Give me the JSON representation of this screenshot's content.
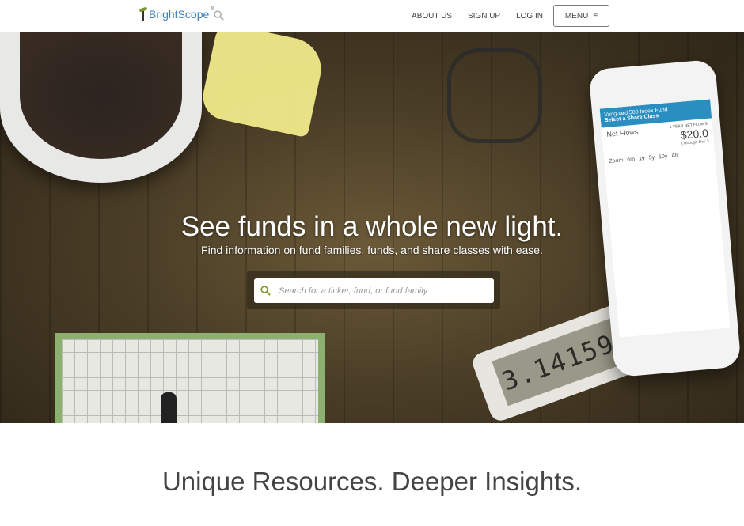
{
  "header": {
    "logo_text": "BrightScope",
    "logo_suffix": "®",
    "nav": [
      "ABOUT US",
      "SIGN UP",
      "LOG IN"
    ],
    "menu_label": "MENU"
  },
  "hero": {
    "title": "See funds in a whole new light.",
    "subtitle": "Find information on fund families, funds, and share classes with ease.",
    "search_placeholder": "Search for a ticker, fund, or fund family",
    "accent": "#7a9a2c",
    "phone": {
      "fund": "Vanguard 500 Index Fund",
      "share_class": "Select a Share Class",
      "metric": "Net Flows",
      "period_label": "1 YEAR NET FLOWS",
      "value": "$20.0",
      "note": "(Through Dec 3",
      "zoom": "Zoom",
      "ranges": [
        "6m",
        "1y",
        "5y",
        "10y",
        "All"
      ]
    },
    "calculator_display": "3.1415926"
  },
  "section": {
    "heading": "Unique Resources. Deeper Insights."
  }
}
